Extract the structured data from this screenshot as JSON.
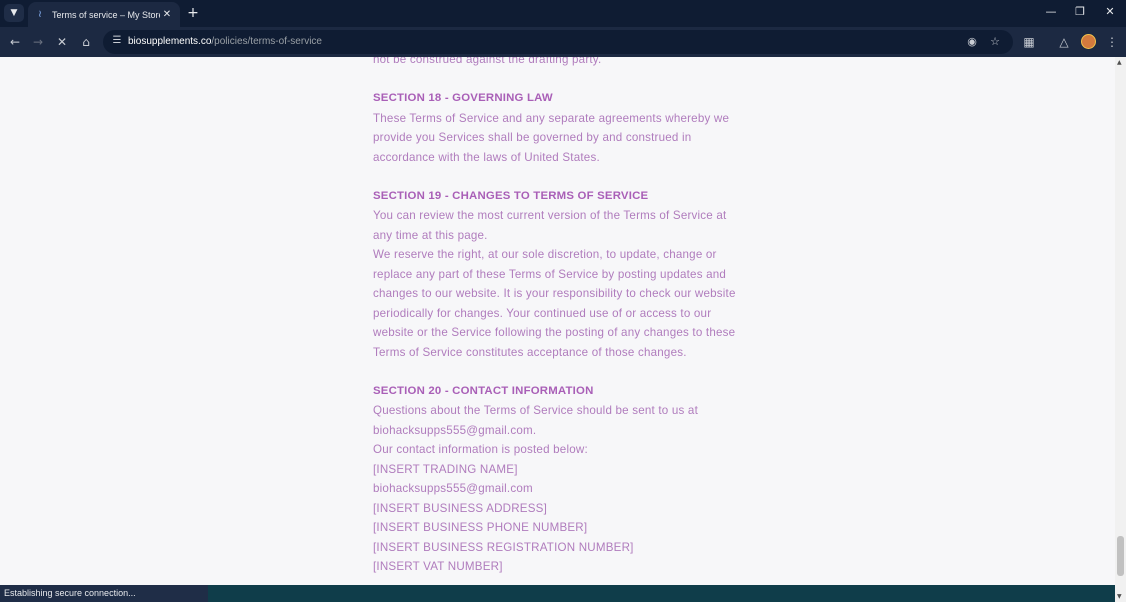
{
  "browser": {
    "tab": {
      "title": "Terms of service – My Store"
    },
    "url": {
      "host": "biosupplements.co",
      "path": "/policies/terms-of-service"
    },
    "status_text": "Establishing secure connection..."
  },
  "article": {
    "lines": [
      {
        "text": "not be construed against the drafting party.",
        "type": "text"
      },
      {
        "text": "",
        "type": "gap"
      },
      {
        "text": "SECTION 18 - GOVERNING LAW",
        "type": "heading"
      },
      {
        "text": "These Terms of Service and any separate agreements whereby we",
        "type": "text"
      },
      {
        "text": "provide you Services shall be governed by and construed in",
        "type": "text"
      },
      {
        "text": "accordance with the laws of United States.",
        "type": "text"
      },
      {
        "text": "",
        "type": "gap"
      },
      {
        "text": "SECTION 19 - CHANGES TO TERMS OF SERVICE",
        "type": "heading"
      },
      {
        "text": "You can review the most current version of the Terms of Service at",
        "type": "text"
      },
      {
        "text": "any time at this page.",
        "type": "text"
      },
      {
        "text": "We reserve the right, at our sole discretion, to update, change or",
        "type": "text"
      },
      {
        "text": "replace any part of these Terms of Service by posting updates and",
        "type": "text"
      },
      {
        "text": "changes to our website. It is your responsibility to check our website",
        "type": "text"
      },
      {
        "text": "periodically for changes. Your continued use of or access to our",
        "type": "text"
      },
      {
        "text": "website or the Service following the posting of any changes to these",
        "type": "text"
      },
      {
        "text": "Terms of Service constitutes acceptance of those changes.",
        "type": "text"
      },
      {
        "text": "",
        "type": "gap"
      },
      {
        "text": "SECTION 20 - CONTACT INFORMATION",
        "type": "heading"
      },
      {
        "text": "Questions about the Terms of Service should be sent to us at",
        "type": "text"
      },
      {
        "text": "biohacksupps555@gmail.com.",
        "type": "text"
      },
      {
        "text": "Our contact information is posted below:",
        "type": "text"
      },
      {
        "text": "[INSERT TRADING NAME]",
        "type": "text"
      },
      {
        "text": "biohacksupps555@gmail.com",
        "type": "text"
      },
      {
        "text": "[INSERT BUSINESS ADDRESS]",
        "type": "text"
      },
      {
        "text": "[INSERT BUSINESS PHONE NUMBER]",
        "type": "text"
      },
      {
        "text": "[INSERT BUSINESS REGISTRATION NUMBER]",
        "type": "text"
      },
      {
        "text": "[INSERT VAT NUMBER]",
        "type": "text"
      }
    ]
  },
  "colors": {
    "body_text": "#b07cbd",
    "heading_text": "#a95fb7",
    "page_bg": "#f7f7f9",
    "chrome_dark": "#0f1c33",
    "chrome_toolbar": "#1c2942"
  }
}
